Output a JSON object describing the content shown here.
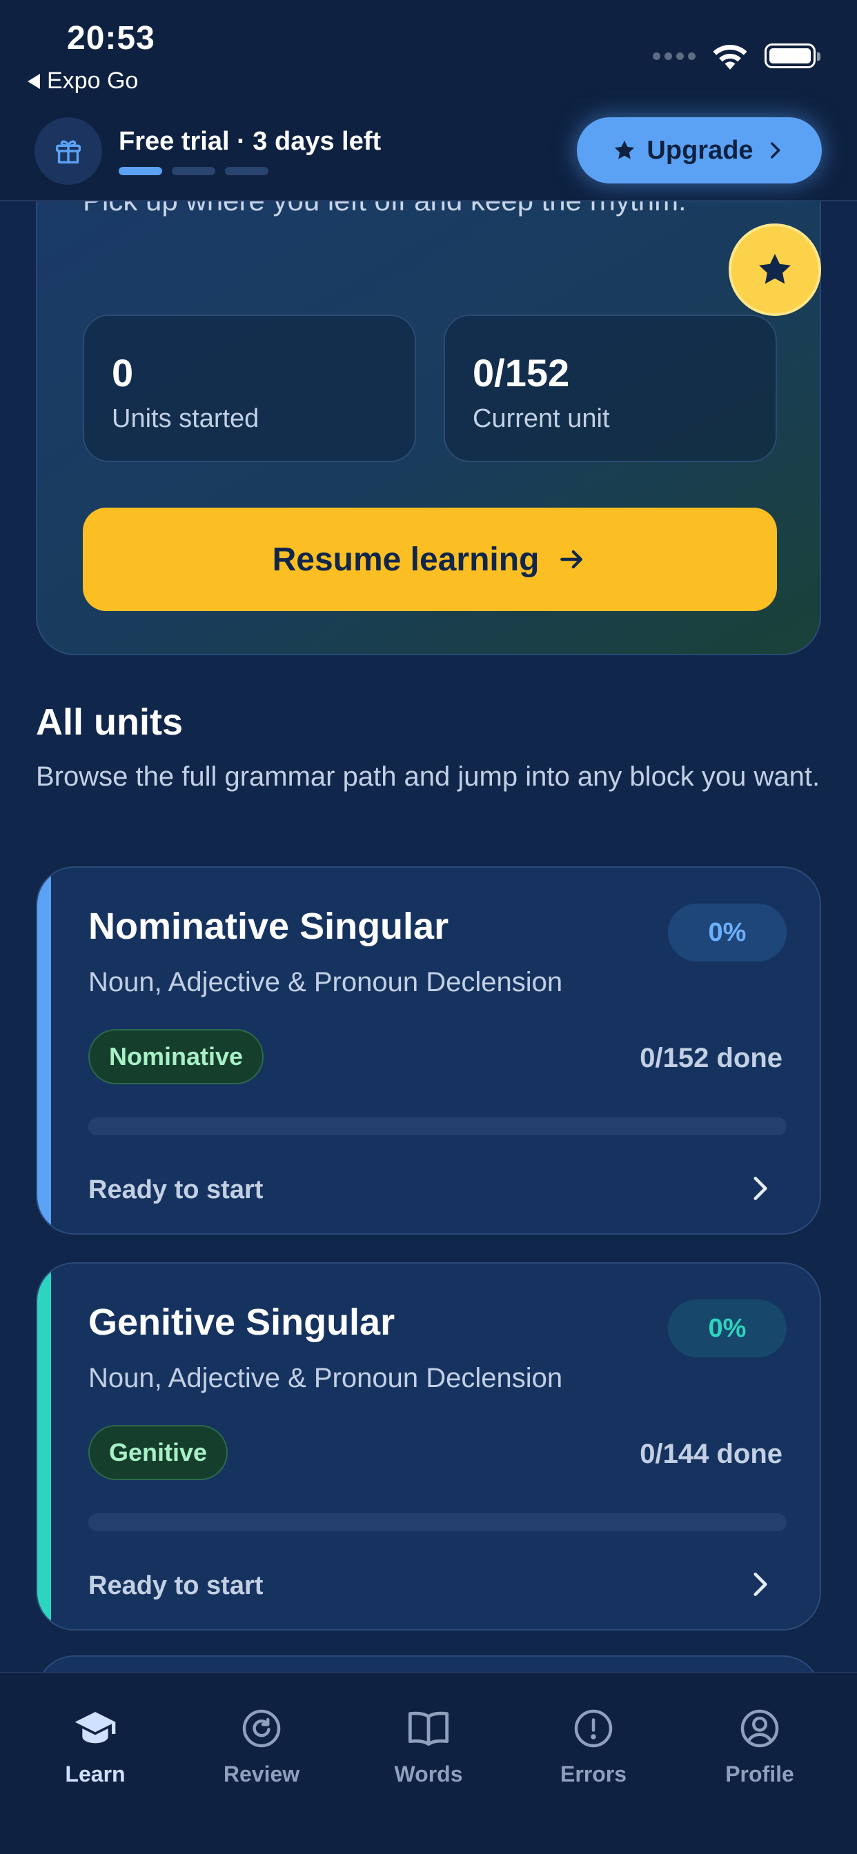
{
  "status_bar": {
    "time": "20:53",
    "back_app": "Expo Go"
  },
  "header": {
    "trial_text": "Free trial · 3 days left",
    "trial_progress": {
      "segments": 3,
      "active": 1
    },
    "upgrade_label": "Upgrade"
  },
  "hero": {
    "subtitle": "Pick up where you left off and keep the rhythm.",
    "stats": [
      {
        "value": "0",
        "label": "Units started"
      },
      {
        "value": "0/152",
        "label": "Current unit"
      }
    ],
    "resume_label": "Resume learning"
  },
  "all_units": {
    "title": "All units",
    "description": "Browse the full grammar path and jump into any block you want.",
    "units": [
      {
        "title": "Nominative Singular",
        "subtitle": "Noun, Adjective & Pronoun Declension",
        "percent": "0%",
        "percent_value": 0,
        "tag": "Nominative",
        "done": "0/152 done",
        "status": "Ready to start",
        "accent_color": "#5ba2f5"
      },
      {
        "title": "Genitive Singular",
        "subtitle": "Noun, Adjective & Pronoun Declension",
        "percent": "0%",
        "percent_value": 0,
        "tag": "Genitive",
        "done": "0/144 done",
        "status": "Ready to start",
        "accent_color": "#2dd4bf"
      }
    ]
  },
  "tabs": [
    {
      "label": "Learn",
      "icon": "graduation-cap-icon",
      "active": true
    },
    {
      "label": "Review",
      "icon": "refresh-icon",
      "active": false
    },
    {
      "label": "Words",
      "icon": "book-icon",
      "active": false
    },
    {
      "label": "Errors",
      "icon": "alert-circle-icon",
      "active": false
    },
    {
      "label": "Profile",
      "icon": "user-circle-icon",
      "active": false
    }
  ],
  "colors": {
    "background": "#10264a",
    "primary_blue": "#5ba2f5",
    "accent_yellow": "#fbbf24",
    "teal": "#2dd4bf",
    "green_tag": "#a8f0c6"
  }
}
